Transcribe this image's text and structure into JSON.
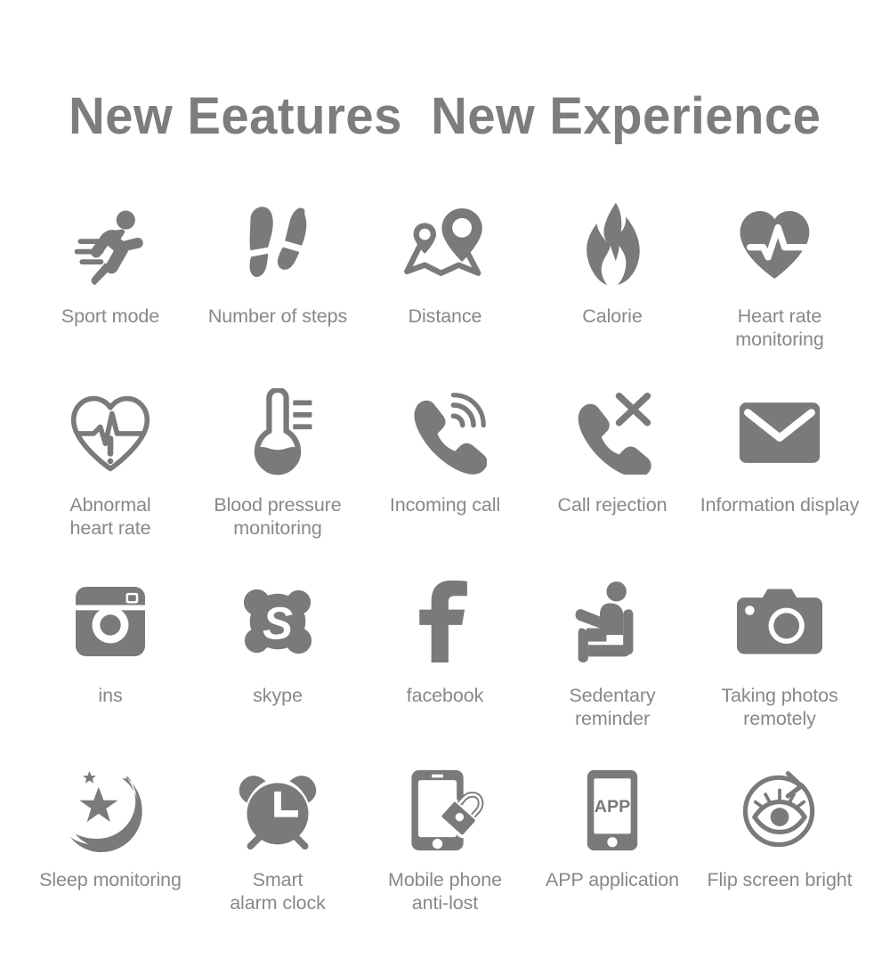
{
  "header": {
    "title": "New Eeatures  New Experience",
    "title_color": "#7d7d7d"
  },
  "theme": {
    "background": "#ffffff",
    "icon_color": "#7a7a7a",
    "label_color": "#888888"
  },
  "features": {
    "columns": 5,
    "rows": 4,
    "items": [
      {
        "icon": "running-person-icon",
        "label": "Sport mode"
      },
      {
        "icon": "footsteps-icon",
        "label": "Number of steps"
      },
      {
        "icon": "map-pins-icon",
        "label": "Distance"
      },
      {
        "icon": "flame-icon",
        "label": "Calorie"
      },
      {
        "icon": "heart-pulse-icon",
        "label": "Heart rate\nmonitoring"
      },
      {
        "icon": "heart-outline-alert-icon",
        "label": "Abnormal\nheart rate"
      },
      {
        "icon": "thermometer-icon",
        "label": "Blood pressure\nmonitoring"
      },
      {
        "icon": "phone-incoming-icon",
        "label": "Incoming call"
      },
      {
        "icon": "phone-reject-icon",
        "label": "Call rejection"
      },
      {
        "icon": "envelope-icon",
        "label": "Information display"
      },
      {
        "icon": "instagram-icon",
        "label": "ins"
      },
      {
        "icon": "skype-icon",
        "label": "skype"
      },
      {
        "icon": "facebook-icon",
        "label": "facebook"
      },
      {
        "icon": "sitting-person-icon",
        "label": "Sedentary\nreminder"
      },
      {
        "icon": "camera-icon",
        "label": "Taking photos\nremotely"
      },
      {
        "icon": "moon-stars-icon",
        "label": "Sleep monitoring"
      },
      {
        "icon": "alarm-clock-icon",
        "label": "Smart\nalarm clock"
      },
      {
        "icon": "phone-lock-icon",
        "label": "Mobile phone\nanti-lost"
      },
      {
        "icon": "phone-app-icon",
        "label": "APP application"
      },
      {
        "icon": "eye-rotate-icon",
        "label": "Flip screen bright"
      }
    ]
  },
  "icon_glyph_text": {
    "phone_app_label": "APP",
    "skype_letter": "S",
    "facebook_letter": "f",
    "alarm_clock_hands": "L"
  }
}
